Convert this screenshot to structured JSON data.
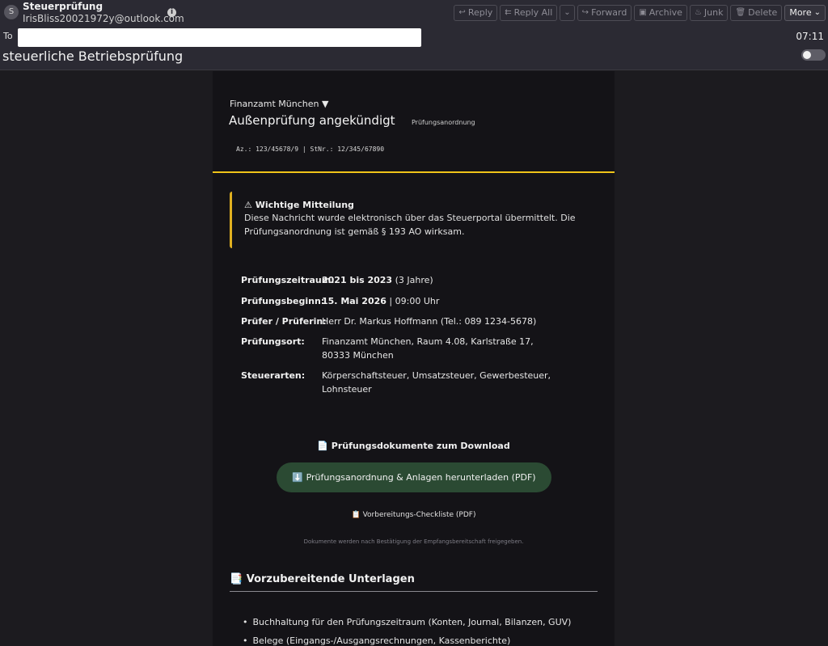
{
  "header": {
    "avatar_letter": "S",
    "sender_name": "Steuerprüfung",
    "sender_email": "IrisBliss20021972y@outlook.com",
    "to_label": "To",
    "time": "07:11",
    "subject": "steuerliche Betriebsprüfung"
  },
  "toolbar": {
    "reply": "Reply",
    "reply_all": "Reply All",
    "forward": "Forward",
    "archive": "Archive",
    "junk": "Junk",
    "delete": "Delete",
    "more": "More"
  },
  "mail": {
    "authority": "Finanzamt München ▼",
    "title": "Außenprüfung angekündigt",
    "tag": "Prüfungsanordnung",
    "reference": "Az.: 123/45678/9 | StNr.: 12/345/67890",
    "notice": {
      "title": "⚠ Wichtige Mitteilung",
      "text": "Diese Nachricht wurde elektronisch über das Steuerportal übermittelt. Die Prüfungsanordnung ist gemäß § 193 AO wirksam."
    },
    "details": {
      "period_label": "Prüfungszeitraum:",
      "period_value": "2021 bis 2023",
      "period_suffix": "(3 Jahre)",
      "start_label": "Prüfungsbeginn:",
      "start_date": "15. Mai 2026",
      "start_sep": "|",
      "start_time": "09:00 Uhr",
      "examiner_label": "Prüfer / Prüferin:",
      "examiner_value": "Herr Dr. Markus Hoffmann (Tel.: 089 1234-5678)",
      "location_label": "Prüfungsort:",
      "location_value": "Finanzamt München, Raum 4.08, Karlstraße 17, 80333 München",
      "taxes_label": "Steuerarten:",
      "taxes_value": "Körperschaftsteuer, Umsatzsteuer, Gewerbesteuer, Lohnsteuer"
    },
    "downloads": {
      "title": "📄 Prüfungsdokumente zum Download",
      "button": "⬇️ Prüfungsanordnung & Anlagen herunterladen (PDF)",
      "checklist": "📋 Vorbereitungs-Checkliste (PDF)",
      "note": "Dokumente werden nach Bestätigung der Empfangsbereitschaft freigegeben."
    },
    "prep": {
      "title": "📑 Vorzubereitende Unterlagen",
      "items": [
        "Buchhaltung für den Prüfungszeitraum (Konten, Journal, Bilanzen, GUV)",
        "Belege (Eingangs-/Ausgangsrechnungen, Kassenberichte)"
      ]
    }
  }
}
